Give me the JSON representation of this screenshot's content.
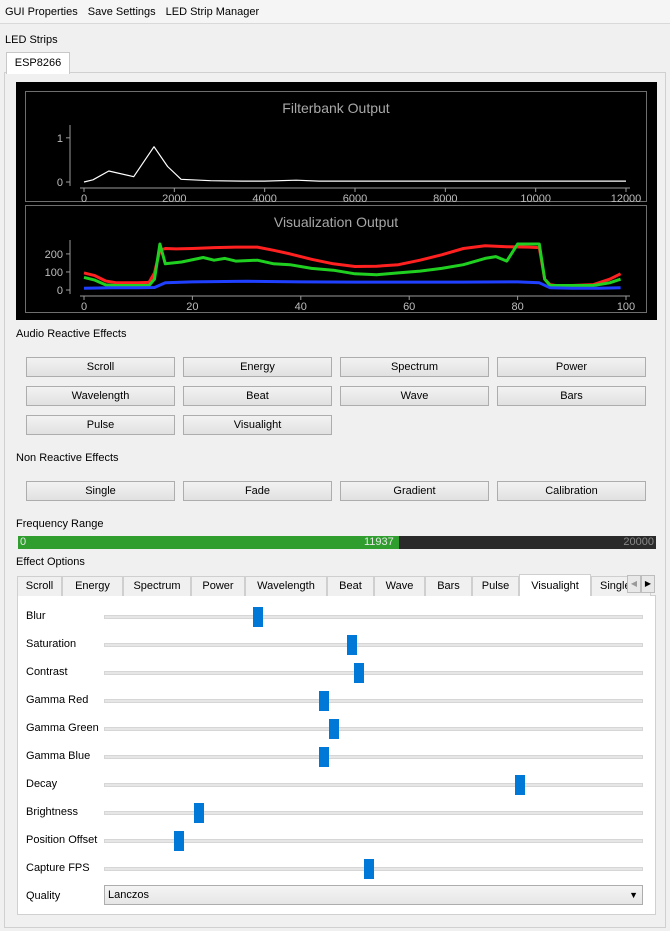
{
  "menu": [
    "GUI Properties",
    "Save Settings",
    "LED Strip Manager"
  ],
  "group_led_strips": "LED Strips",
  "strip_tab": "ESP8266",
  "filterbank": {
    "title": "Filterbank Output",
    "yticks": [
      "1",
      "0"
    ],
    "xticks": [
      "0",
      "2000",
      "4000",
      "6000",
      "8000",
      "10000",
      "12000"
    ]
  },
  "visualization": {
    "title": "Visualization Output",
    "yticks": [
      "200",
      "100",
      "0"
    ],
    "xticks": [
      "0",
      "20",
      "40",
      "60",
      "80",
      "100"
    ]
  },
  "chart_data": [
    {
      "type": "line",
      "title": "Filterbank Output",
      "xlim": [
        0,
        12000
      ],
      "ylim": [
        0,
        1.2
      ],
      "grid": false,
      "series": [
        {
          "color": "#ffffff",
          "x": [
            0,
            200,
            550,
            1100,
            1550,
            1850,
            2150,
            2800,
            3500,
            4000,
            4700,
            5200,
            6000,
            7000,
            8000,
            9000,
            10000,
            11000,
            12000
          ],
          "values": [
            0.0,
            0.05,
            0.25,
            0.12,
            0.8,
            0.35,
            0.06,
            0.03,
            0.02,
            0.02,
            0.04,
            0.02,
            0.02,
            0.02,
            0.02,
            0.02,
            0.02,
            0.02,
            0.02
          ]
        }
      ]
    },
    {
      "type": "line",
      "title": "Visualization Output",
      "xlim": [
        0,
        100
      ],
      "ylim": [
        0,
        255
      ],
      "grid": false,
      "series": [
        {
          "color": "#ff2020",
          "x": [
            0,
            2,
            4,
            6,
            8,
            10,
            12,
            13,
            14,
            15,
            17,
            20,
            24,
            28,
            32,
            35,
            38,
            42,
            46,
            50,
            54,
            58,
            62,
            66,
            70,
            74,
            78,
            82,
            84,
            85,
            86,
            87,
            90,
            94,
            97,
            99
          ],
          "values": [
            95,
            80,
            50,
            40,
            40,
            40,
            42,
            95,
            220,
            230,
            228,
            230,
            235,
            238,
            238,
            220,
            200,
            170,
            145,
            130,
            132,
            140,
            165,
            195,
            230,
            245,
            240,
            238,
            235,
            60,
            30,
            25,
            25,
            30,
            60,
            90
          ]
        },
        {
          "color": "#20d020",
          "x": [
            0,
            2,
            4,
            6,
            8,
            10,
            12,
            13,
            14,
            15,
            18,
            22,
            24,
            26,
            28,
            32,
            35,
            38,
            42,
            46,
            50,
            54,
            58,
            62,
            66,
            70,
            74,
            76,
            78,
            80,
            82,
            84,
            85,
            86,
            90,
            94,
            97,
            99
          ],
          "values": [
            70,
            55,
            28,
            25,
            25,
            25,
            25,
            60,
            255,
            145,
            155,
            180,
            165,
            175,
            160,
            165,
            145,
            140,
            120,
            110,
            90,
            85,
            95,
            105,
            120,
            140,
            175,
            185,
            160,
            255,
            255,
            255,
            60,
            25,
            25,
            25,
            40,
            60
          ]
        },
        {
          "color": "#2040ff",
          "x": [
            0,
            5,
            10,
            13,
            15,
            20,
            30,
            40,
            50,
            60,
            70,
            80,
            84,
            86,
            90,
            95,
            99
          ],
          "values": [
            10,
            12,
            12,
            14,
            40,
            45,
            48,
            45,
            44,
            44,
            44,
            45,
            40,
            12,
            10,
            10,
            12
          ]
        }
      ]
    }
  ],
  "group_audio": "Audio Reactive Effects",
  "audio_effects": [
    "Scroll",
    "Energy",
    "Spectrum",
    "Power",
    "Wavelength",
    "Beat",
    "Wave",
    "Bars",
    "Pulse",
    "Visualight"
  ],
  "group_nonreactive": "Non Reactive Effects",
  "non_reactive_effects": [
    "Single",
    "Fade",
    "Gradient",
    "Calibration"
  ],
  "freq_range": {
    "label": "Frequency Range",
    "min_text": "0",
    "value_text": "11937",
    "max_text": "20000",
    "value": 11937,
    "max": 20000
  },
  "group_effect_options": "Effect Options",
  "effect_tabs": [
    "Scroll",
    "Energy",
    "Spectrum",
    "Power",
    "Wavelength",
    "Beat",
    "Wave",
    "Bars",
    "Pulse",
    "Visualight",
    "Single"
  ],
  "active_tab": "Visualight",
  "scroll_arrows": [
    "◀",
    "▶"
  ],
  "sliders": [
    {
      "label": "Blur",
      "level": 0.285
    },
    {
      "label": "Saturation",
      "level": 0.461
    },
    {
      "label": "Contrast",
      "level": 0.474
    },
    {
      "label": "Gamma Red",
      "level": 0.408
    },
    {
      "label": "Gamma Green",
      "level": 0.427
    },
    {
      "label": "Gamma Blue",
      "level": 0.408
    },
    {
      "label": "Decay",
      "level": 0.772
    },
    {
      "label": "Brightness",
      "level": 0.176
    },
    {
      "label": "Position Offset",
      "level": 0.139
    },
    {
      "label": "Capture FPS",
      "level": 0.491
    }
  ],
  "quality": {
    "label": "Quality",
    "value": "Lanczos",
    "arrow": "▼"
  }
}
